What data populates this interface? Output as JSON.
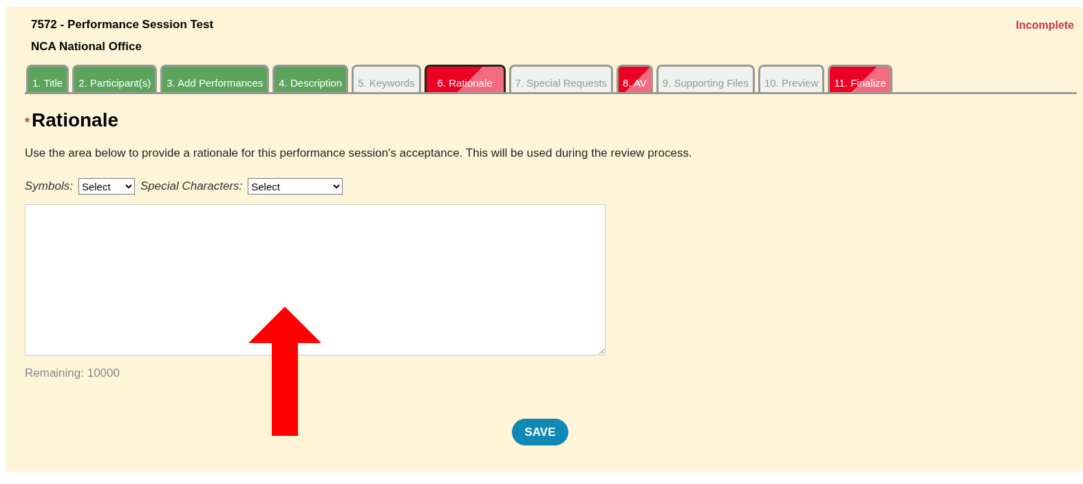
{
  "header": {
    "title": "7572 - Performance Session Test",
    "organization": "NCA National Office",
    "status": "Incomplete"
  },
  "tabs": [
    {
      "label": "1. Title",
      "kind": "complete",
      "selected": false
    },
    {
      "label": "2. Participant(s)",
      "kind": "complete",
      "selected": false
    },
    {
      "label": "3. Add Performances",
      "kind": "complete",
      "selected": false
    },
    {
      "label": "4. Description",
      "kind": "complete",
      "selected": false
    },
    {
      "label": "5. Keywords",
      "kind": "empty",
      "selected": false
    },
    {
      "label": "6. Rationale",
      "kind": "required",
      "selected": true
    },
    {
      "label": "7. Special Requests",
      "kind": "empty",
      "selected": false
    },
    {
      "label": "8. AV",
      "kind": "required",
      "selected": false
    },
    {
      "label": "9. Supporting Files",
      "kind": "empty",
      "selected": false
    },
    {
      "label": "10. Preview",
      "kind": "empty",
      "selected": false
    },
    {
      "label": "11. Finalize",
      "kind": "required",
      "selected": false
    }
  ],
  "section": {
    "required_mark": "*",
    "heading": "Rationale",
    "instructions": "Use the area below to provide a rationale for this performance session's acceptance. This will be used during the review process."
  },
  "symbols": {
    "label": "Symbols:",
    "value": "Select"
  },
  "special_characters": {
    "label": "Special Characters:",
    "value": "Select"
  },
  "remaining": "Remaining: 10000",
  "save_button": "SAVE"
}
